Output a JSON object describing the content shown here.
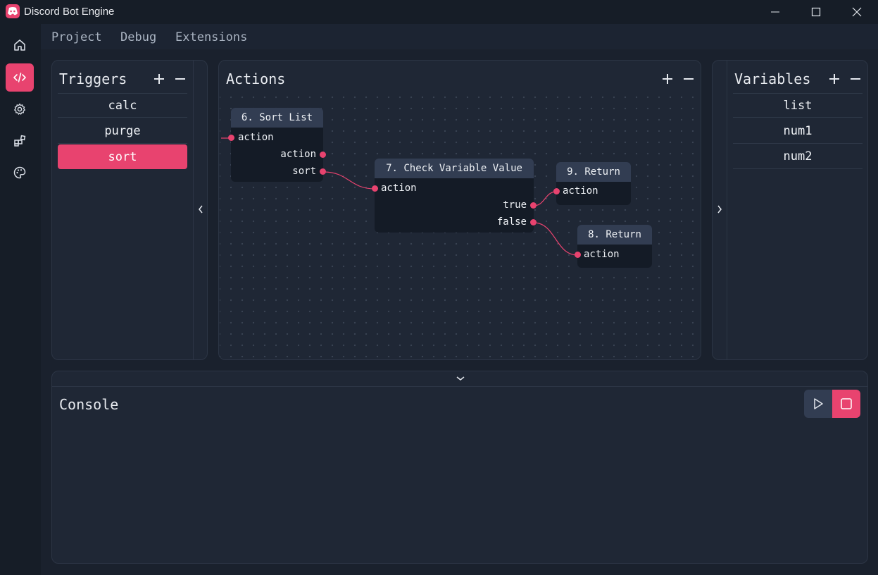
{
  "window": {
    "title": "Discord Bot Engine"
  },
  "menu": {
    "items": [
      "Project",
      "Debug",
      "Extensions"
    ]
  },
  "sidebar": {
    "icons": [
      "home-icon",
      "code-icon",
      "gear-icon",
      "extensions-icon",
      "palette-icon"
    ],
    "active": "code-icon"
  },
  "triggers": {
    "title": "Triggers",
    "items": [
      "calc",
      "purge",
      "sort"
    ],
    "selected": "sort"
  },
  "actions": {
    "title": "Actions",
    "nodes": {
      "sort_list": {
        "title": "6. Sort List",
        "input": "action",
        "outputs": [
          "action",
          "sort"
        ]
      },
      "check_var": {
        "title": "7. Check Variable Value",
        "input": "action",
        "outputs": [
          "true",
          "false"
        ]
      },
      "return9": {
        "title": "9. Return",
        "input": "action"
      },
      "return8": {
        "title": "8. Return",
        "input": "action"
      }
    }
  },
  "variables": {
    "title": "Variables",
    "items": [
      "list",
      "num1",
      "num2"
    ]
  },
  "console": {
    "title": "Console"
  },
  "colors": {
    "accent": "#e8436f",
    "panel": "#1f2735",
    "background": "#161d27",
    "node_header": "#323d52"
  }
}
